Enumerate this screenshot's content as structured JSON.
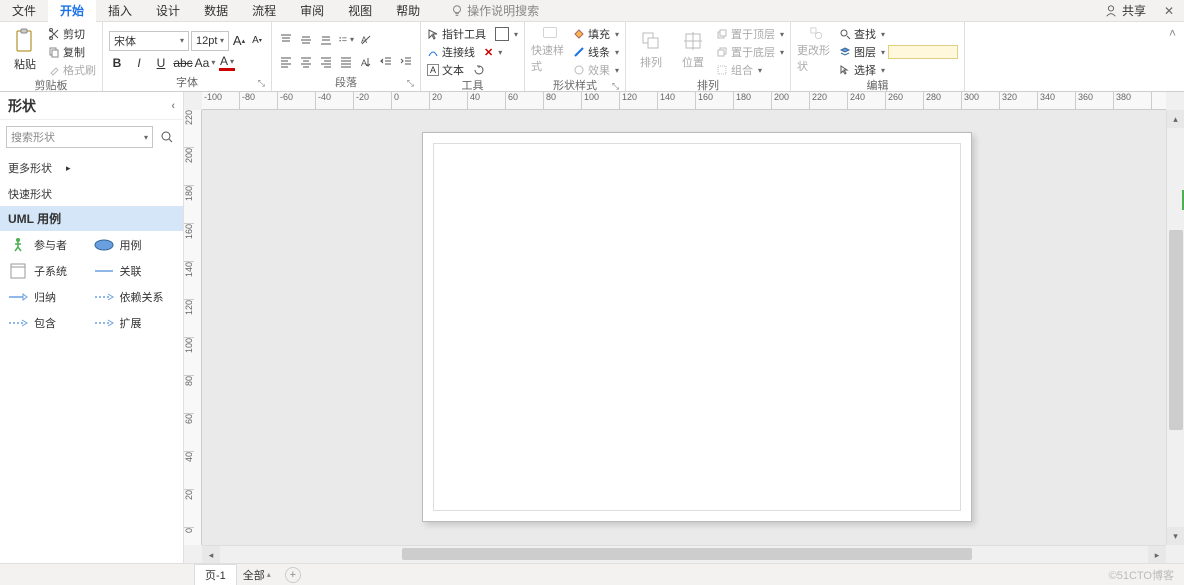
{
  "tabs": [
    "文件",
    "开始",
    "插入",
    "设计",
    "数据",
    "流程",
    "审阅",
    "视图",
    "帮助"
  ],
  "active_tab": 1,
  "tell_me": "操作说明搜索",
  "share": "共享",
  "ribbon": {
    "clipboard": {
      "paste": "粘贴",
      "cut": "剪切",
      "copy": "复制",
      "format_painter": "格式刷",
      "group": "剪贴板"
    },
    "font": {
      "name": "宋体",
      "size": "12pt",
      "group": "字体"
    },
    "paragraph": {
      "group": "段落"
    },
    "tools": {
      "pointer": "指针工具",
      "connector": "连接线",
      "text": "文本",
      "group": "工具"
    },
    "shape_styles": {
      "quick": "快速样式",
      "fill": "填充",
      "line": "线条",
      "effects": "效果",
      "group": "形状样式"
    },
    "arrange": {
      "arrange": "排列",
      "position": "位置",
      "bring_front": "置于顶层",
      "send_back": "置于底层",
      "group_cmd": "组合",
      "group": "排列"
    },
    "edit": {
      "change_shape": "更改形状",
      "find": "查找",
      "layers": "图层",
      "select": "选择",
      "group": "编辑"
    }
  },
  "sidepanel": {
    "title": "形状",
    "search_placeholder": "搜索形状",
    "more": "更多形状",
    "section_quick": "快速形状",
    "active_set": "UML 用例",
    "shapes": [
      {
        "label": "参与者",
        "icon": "actor"
      },
      {
        "label": "用例",
        "icon": "usecase"
      },
      {
        "label": "子系统",
        "icon": "subsystem"
      },
      {
        "label": "关联",
        "icon": "assoc"
      },
      {
        "label": "归纳",
        "icon": "gen"
      },
      {
        "label": "依赖关系",
        "icon": "dep"
      },
      {
        "label": "包含",
        "icon": "include"
      },
      {
        "label": "扩展",
        "icon": "extend"
      }
    ]
  },
  "ruler_h": [
    "-100",
    "-80",
    "-60",
    "-40",
    "-20",
    "0",
    "20",
    "40",
    "60",
    "80",
    "100",
    "120",
    "140",
    "160",
    "180",
    "200",
    "220",
    "240",
    "260",
    "280",
    "300",
    "320",
    "340",
    "360",
    "380"
  ],
  "ruler_v": [
    "220",
    "200",
    "180",
    "160",
    "140",
    "120",
    "100",
    "80",
    "60",
    "40",
    "20",
    "0"
  ],
  "statusbar": {
    "page": "页-1",
    "all": "全部"
  },
  "watermark": "©51CTO博客"
}
